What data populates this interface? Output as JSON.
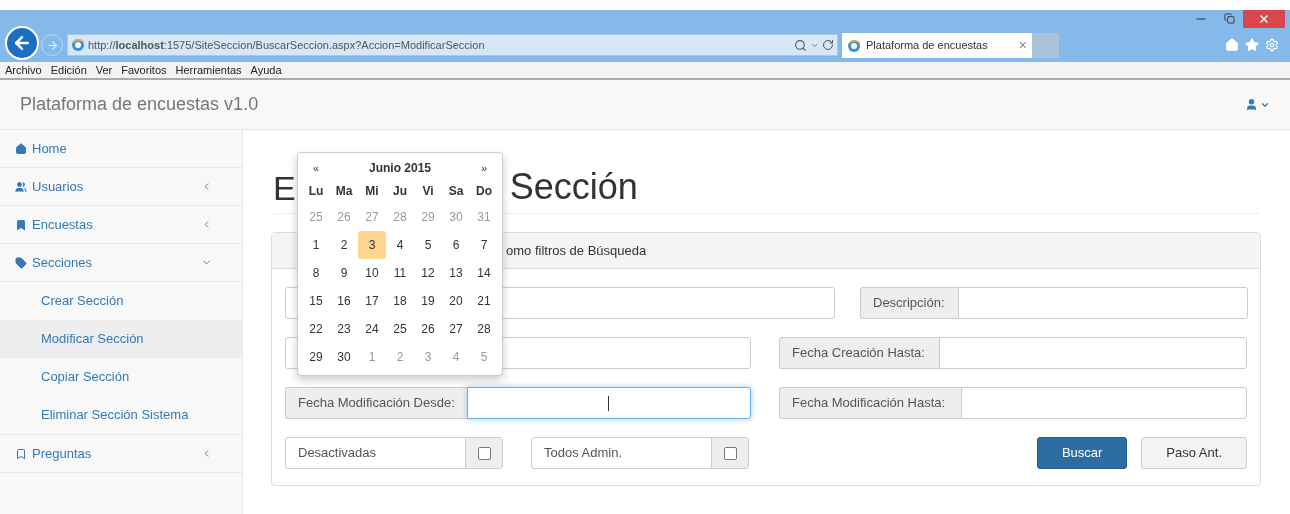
{
  "browser": {
    "address": "http://**localhost**:1575/SiteSeccion/BuscarSeccion.aspx?Accion=ModificarSeccion",
    "tab": {
      "title": "Plataforma de encuestas",
      "close": "×"
    },
    "menu": [
      "Archivo",
      "Edición",
      "Ver",
      "Favoritos",
      "Herramientas",
      "Ayuda"
    ]
  },
  "navbar": {
    "brand": "Plataforma de encuestas v1.0"
  },
  "sidebar": {
    "items": [
      {
        "label": "Home"
      },
      {
        "label": "Usuarios",
        "expanded": false
      },
      {
        "label": "Encuestas",
        "expanded": false
      },
      {
        "label": "Secciones",
        "expanded": true,
        "children": [
          {
            "label": "Crear Sección",
            "selected": false
          },
          {
            "label": "Modificar Sección",
            "selected": true
          },
          {
            "label": "Copiar Sección",
            "selected": false
          },
          {
            "label": "Eliminar Sección Sistema",
            "selected": false
          }
        ]
      },
      {
        "label": "Preguntas",
        "expanded": false
      }
    ]
  },
  "heading": {
    "visible_start": "E",
    "visible_end": "Sección"
  },
  "panel": {
    "header": "omo filtros de Búsqueda",
    "rows": [
      [
        {
          "kind": "input",
          "focused": false
        },
        {
          "kind": "input",
          "label": "Descripción:",
          "focused": false
        }
      ],
      [
        {
          "kind": "input",
          "focused": false
        },
        {
          "kind": "input",
          "label": "Fecha Creación Hasta:",
          "focused": false
        }
      ],
      [
        {
          "kind": "input",
          "label": "Fecha Modificación Desde:",
          "focused": true
        },
        {
          "kind": "input",
          "label": "Fecha Modificación Hasta:",
          "focused": false
        }
      ],
      [
        {
          "kind": "checkbox",
          "label": "Desactivadas",
          "checked": false
        },
        {
          "kind": "checkbox",
          "label": "Todos Admin.",
          "checked": false
        }
      ]
    ],
    "buttons": [
      {
        "label": "Buscar",
        "primary": true
      },
      {
        "label": "Paso Ant.",
        "primary": false
      }
    ]
  },
  "datepicker": {
    "prev": "«",
    "title": "Junio 2015",
    "next": "»",
    "weekdays": [
      "Lu",
      "Ma",
      "Mi",
      "Ju",
      "Vi",
      "Sa",
      "Do"
    ],
    "weeks": [
      [
        {
          "day": "25",
          "muted": true,
          "selected": false
        },
        {
          "day": "26",
          "muted": true,
          "selected": false
        },
        {
          "day": "27",
          "muted": true,
          "selected": false
        },
        {
          "day": "28",
          "muted": true,
          "selected": false
        },
        {
          "day": "29",
          "muted": true,
          "selected": false
        },
        {
          "day": "30",
          "muted": true,
          "selected": false
        },
        {
          "day": "31",
          "muted": true,
          "selected": false
        }
      ],
      [
        {
          "day": "1",
          "muted": false,
          "selected": false
        },
        {
          "day": "2",
          "muted": false,
          "selected": false
        },
        {
          "day": "3",
          "muted": false,
          "selected": true
        },
        {
          "day": "4",
          "muted": false,
          "selected": false
        },
        {
          "day": "5",
          "muted": false,
          "selected": false
        },
        {
          "day": "6",
          "muted": false,
          "selected": false
        },
        {
          "day": "7",
          "muted": false,
          "selected": false
        }
      ],
      [
        {
          "day": "8",
          "muted": false,
          "selected": false
        },
        {
          "day": "9",
          "muted": false,
          "selected": false
        },
        {
          "day": "10",
          "muted": false,
          "selected": false
        },
        {
          "day": "11",
          "muted": false,
          "selected": false
        },
        {
          "day": "12",
          "muted": false,
          "selected": false
        },
        {
          "day": "13",
          "muted": false,
          "selected": false
        },
        {
          "day": "14",
          "muted": false,
          "selected": false
        }
      ],
      [
        {
          "day": "15",
          "muted": false,
          "selected": false
        },
        {
          "day": "16",
          "muted": false,
          "selected": false
        },
        {
          "day": "17",
          "muted": false,
          "selected": false
        },
        {
          "day": "18",
          "muted": false,
          "selected": false
        },
        {
          "day": "19",
          "muted": false,
          "selected": false
        },
        {
          "day": "20",
          "muted": false,
          "selected": false
        },
        {
          "day": "21",
          "muted": false,
          "selected": false
        }
      ],
      [
        {
          "day": "22",
          "muted": false,
          "selected": false
        },
        {
          "day": "23",
          "muted": false,
          "selected": false
        },
        {
          "day": "24",
          "muted": false,
          "selected": false
        },
        {
          "day": "25",
          "muted": false,
          "selected": false
        },
        {
          "day": "26",
          "muted": false,
          "selected": false
        },
        {
          "day": "27",
          "muted": false,
          "selected": false
        },
        {
          "day": "28",
          "muted": false,
          "selected": false
        }
      ],
      [
        {
          "day": "29",
          "muted": false,
          "selected": false
        },
        {
          "day": "30",
          "muted": false,
          "selected": false
        },
        {
          "day": "1",
          "muted": true,
          "selected": false
        },
        {
          "day": "2",
          "muted": true,
          "selected": false
        },
        {
          "day": "3",
          "muted": true,
          "selected": false
        },
        {
          "day": "4",
          "muted": true,
          "selected": false
        },
        {
          "day": "5",
          "muted": true,
          "selected": false
        }
      ]
    ]
  }
}
